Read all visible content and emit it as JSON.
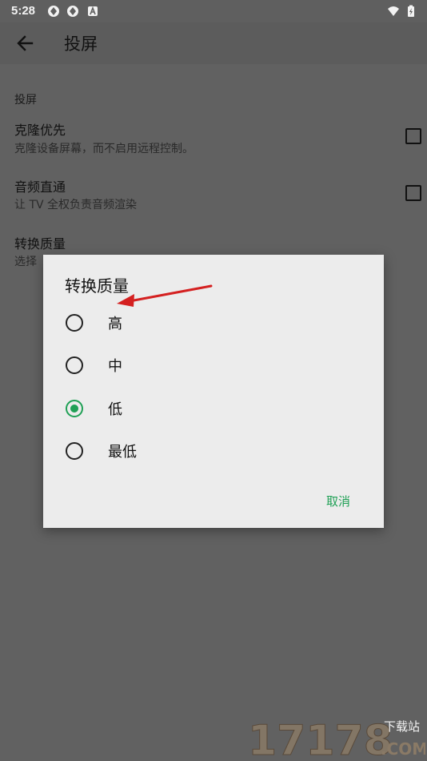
{
  "status_bar": {
    "time": "5:28"
  },
  "app_bar": {
    "title": "投屏"
  },
  "preferences": {
    "category": "投屏",
    "items": [
      {
        "title": "克隆优先",
        "summary": "克隆设备屏幕，而不启用远程控制。"
      },
      {
        "title": "音频直通",
        "summary": "让 TV 全权负责音频渲染"
      },
      {
        "title": "转换质量",
        "summary": "选择"
      }
    ]
  },
  "dialog": {
    "title": "转换质量",
    "options": [
      {
        "label": "高",
        "selected": false
      },
      {
        "label": "中",
        "selected": false
      },
      {
        "label": "低",
        "selected": true
      },
      {
        "label": "最低",
        "selected": false
      }
    ],
    "cancel": "取消"
  },
  "watermark": {
    "number": "17178",
    "domain": ".COM",
    "tagline": "下载站"
  },
  "colors": {
    "accent": "#1fa055",
    "scrim": "#616161",
    "dialog_bg": "#ececec",
    "arrow": "#d42020"
  }
}
